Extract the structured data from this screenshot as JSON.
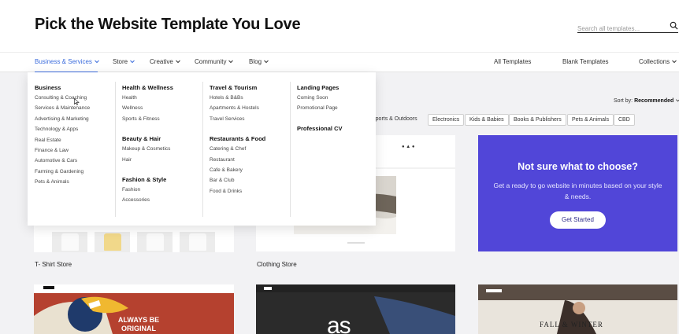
{
  "header": {
    "title": "Pick the Website Template You Love",
    "search_placeholder": "Search all templates..."
  },
  "nav": {
    "left": [
      {
        "label": "Business & Services",
        "active": true
      },
      {
        "label": "Store"
      },
      {
        "label": "Creative"
      },
      {
        "label": "Community"
      },
      {
        "label": "Blog"
      }
    ],
    "right": [
      "All Templates",
      "Blank Templates",
      "Collections"
    ]
  },
  "dropdown": {
    "col1": {
      "heading": "Business",
      "items": [
        "Consulting & Coaching",
        "Services & Maintenance",
        "Advertising & Marketing",
        "Technology & Apps",
        "Real Estate",
        "Finance & Law",
        "Automotive & Cars",
        "Farming & Gardening",
        "Pets & Animals"
      ]
    },
    "col2a": {
      "heading": "Health & Wellness",
      "items": [
        "Health",
        "Wellness",
        "Sports & Fitness"
      ]
    },
    "col2b": {
      "heading": "Beauty & Hair",
      "items": [
        "Makeup & Cosmetics",
        "Hair"
      ]
    },
    "col2c": {
      "heading": "Fashion & Style",
      "items": [
        "Fashion",
        "Accessories"
      ]
    },
    "col3a": {
      "heading": "Travel & Tourism",
      "items": [
        "Hotels & B&Bs",
        "Apartments & Hostels",
        "Travel Services"
      ]
    },
    "col3b": {
      "heading": "Restaurants & Food",
      "items": [
        "Catering & Chef",
        "Restaurant",
        "Cafe & Bakery",
        "Bar & Club",
        "Food & Drinks"
      ]
    },
    "col4a": {
      "heading": "Landing Pages",
      "items": [
        "Coming Soon",
        "Promotional Page"
      ]
    },
    "col4b": {
      "heading": "Professional CV",
      "items": []
    }
  },
  "sort": {
    "label": "Sort by:",
    "value": "Recommended"
  },
  "filters": [
    "Sports & Outdoors",
    "Electronics",
    "Kids & Babies",
    "Books & Publishers",
    "Pets & Animals",
    "CBD"
  ],
  "cards": {
    "card1_label": "T- Shirt Store",
    "card2_label": "Clothing Store"
  },
  "promo": {
    "title": "Not sure what to choose?",
    "text": "Get a ready to go website in minutes based on your style & needs.",
    "button": "Get Started"
  },
  "thumbs": {
    "always_text": "ALWAYS BE ORIGINAL",
    "fall_text": "FALL & WINTER",
    "as_logo": "as"
  },
  "colors": {
    "accent": "#3a6bdc",
    "promo_bg": "#5146d8"
  }
}
